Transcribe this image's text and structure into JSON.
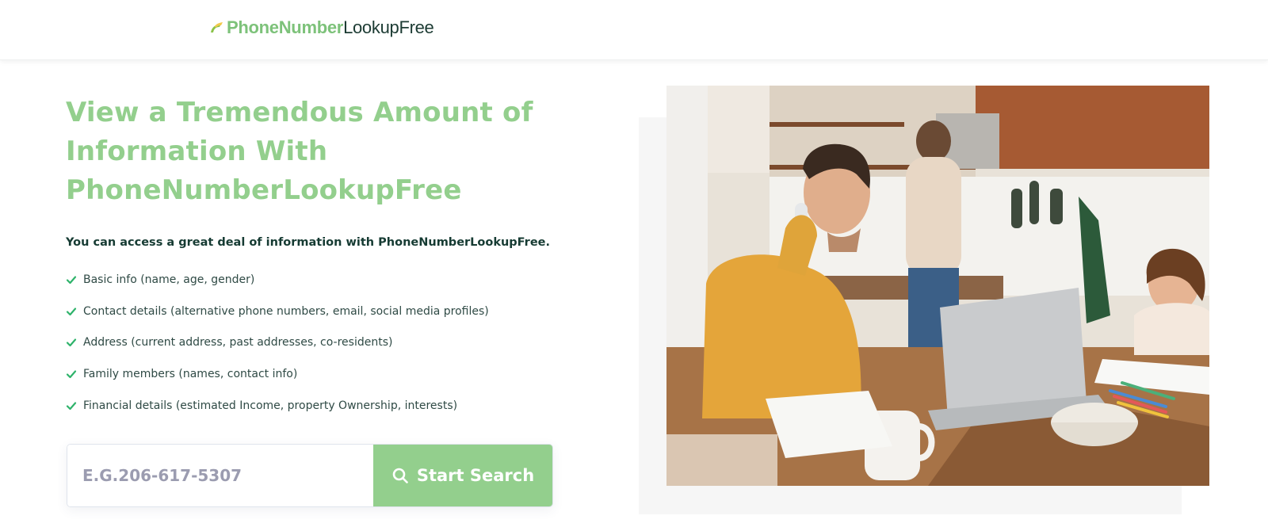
{
  "header": {
    "logo_part1": "PhoneNumber",
    "logo_part2": "LookupFree"
  },
  "hero": {
    "title_line1": "View a Tremendous Amount of",
    "title_line2": "Information With",
    "title_line3": "PhoneNumberLookupFree",
    "intro": "You can access a great deal of information with PhoneNumberLookupFree.",
    "features": [
      "Basic info (name, age, gender)",
      "Contact details (alternative phone numbers, email, social media profiles)",
      "Address (current address, past addresses, co-residents)",
      "Family members (names, contact info)",
      "Financial details (estimated Income, property Ownership, interests)"
    ]
  },
  "search": {
    "placeholder": "E.G.206-617-5307",
    "button_label": "Start Search"
  },
  "colors": {
    "brand_green": "#93cf8d",
    "dark_text": "#163b33",
    "check_green": "#2fb36b"
  },
  "icons": {
    "logo": "logo-mark-icon",
    "feature": "check-icon",
    "search": "search-icon"
  }
}
